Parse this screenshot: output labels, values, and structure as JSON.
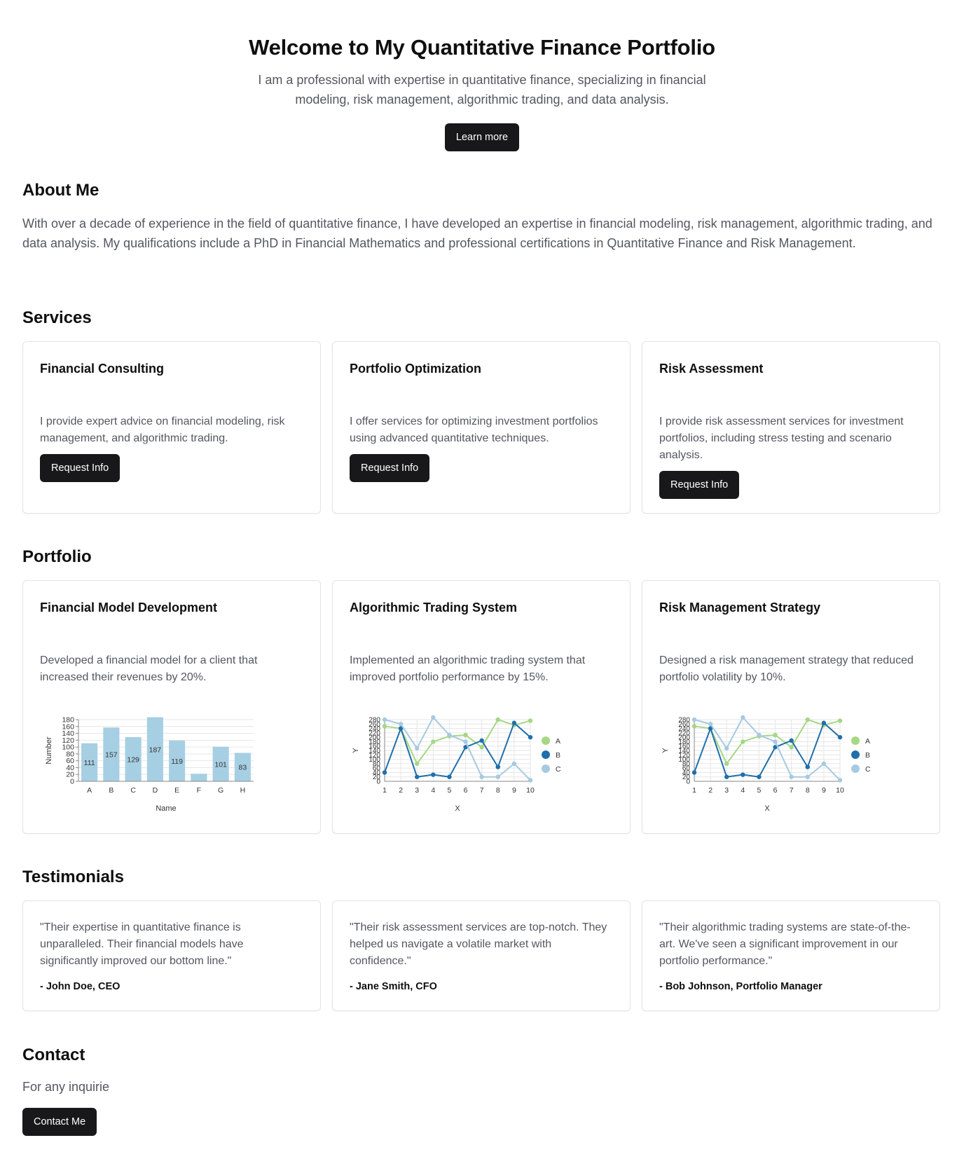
{
  "hero": {
    "title": "Welcome to My Quantitative Finance Portfolio",
    "subtitle": "I am a professional with expertise in quantitative finance, specializing in financial modeling, risk management, algorithmic trading, and data analysis.",
    "cta_label": "Learn more"
  },
  "about": {
    "heading": "About Me",
    "text": "With over a decade of experience in the field of quantitative finance, I have developed an expertise in financial modeling, risk management, algorithmic trading, and data analysis. My qualifications include a PhD in Financial Mathematics and professional certifications in Quantitative Finance and Risk Management."
  },
  "services": {
    "heading": "Services",
    "items": [
      {
        "title": "Financial Consulting",
        "description": "I provide expert advice on financial modeling, risk management, and algorithmic trading.",
        "button": "Request Info"
      },
      {
        "title": "Portfolio Optimization",
        "description": "I offer services for optimizing investment portfolios using advanced quantitative techniques.",
        "button": "Request Info"
      },
      {
        "title": "Risk Assessment",
        "description": "I provide risk assessment services for investment portfolios, including stress testing and scenario analysis.",
        "button": "Request Info"
      }
    ]
  },
  "portfolio": {
    "heading": "Portfolio",
    "items": [
      {
        "title": "Financial Model Development",
        "description": "Developed a financial model for a client that increased their revenues by 20%."
      },
      {
        "title": "Algorithmic Trading System",
        "description": "Implemented an algorithmic trading system that improved portfolio performance by 15%."
      },
      {
        "title": "Risk Management Strategy",
        "description": "Designed a risk management strategy that reduced portfolio volatility by 10%."
      }
    ]
  },
  "testimonials": {
    "heading": "Testimonials",
    "items": [
      {
        "quote": "\"Their expertise in quantitative finance is unparalleled. Their financial models have significantly improved our bottom line.\"",
        "author": "- John Doe, CEO"
      },
      {
        "quote": "\"Their risk assessment services are top-notch. They helped us navigate a volatile market with confidence.\"",
        "author": "- Jane Smith, CFO"
      },
      {
        "quote": "\"Their algorithmic trading systems are state-of-the-art. We've seen a significant improvement in our portfolio performance.\"",
        "author": "- Bob Johnson, Portfolio Manager"
      }
    ]
  },
  "contact": {
    "heading": "Contact",
    "text": "For any inquirie",
    "button": "Contact Me"
  },
  "colors": {
    "bar": "#a6cfe3",
    "series_a": "#a6d785",
    "series_b": "#1f6fab",
    "series_c": "#a6cae0",
    "button": "#18181b"
  },
  "chart_data": [
    {
      "type": "bar",
      "title": "",
      "xlabel": "Name",
      "ylabel": "Number",
      "categories": [
        "A",
        "B",
        "C",
        "D",
        "E",
        "F",
        "G",
        "H"
      ],
      "values": [
        111,
        157,
        129,
        187,
        119,
        22,
        101,
        83
      ],
      "data_labels": [
        "111",
        "157",
        "129",
        "187",
        "119",
        "",
        "101",
        "83"
      ],
      "ylim": [
        0,
        180
      ],
      "yticks": [
        0,
        20,
        40,
        60,
        80,
        100,
        120,
        140,
        160,
        180
      ],
      "grid": true
    },
    {
      "type": "line",
      "title": "",
      "xlabel": "X",
      "ylabel": "Y",
      "x": [
        1,
        2,
        3,
        4,
        5,
        6,
        7,
        8,
        9,
        10
      ],
      "ylim": [
        0,
        280
      ],
      "yticks": [
        0,
        20,
        40,
        60,
        80,
        100,
        120,
        140,
        160,
        180,
        200,
        220,
        240,
        260,
        280
      ],
      "legend": "right",
      "grid": true,
      "series": [
        {
          "name": "A",
          "values": [
            250,
            240,
            80,
            180,
            205,
            210,
            155,
            280,
            255,
            275
          ]
        },
        {
          "name": "B",
          "values": [
            40,
            240,
            20,
            30,
            20,
            155,
            185,
            65,
            265,
            200
          ]
        },
        {
          "name": "C",
          "values": [
            280,
            260,
            150,
            290,
            210,
            180,
            20,
            20,
            80,
            5
          ]
        }
      ]
    },
    {
      "type": "line",
      "title": "",
      "xlabel": "X",
      "ylabel": "Y",
      "x": [
        1,
        2,
        3,
        4,
        5,
        6,
        7,
        8,
        9,
        10
      ],
      "ylim": [
        0,
        280
      ],
      "yticks": [
        0,
        20,
        40,
        60,
        80,
        100,
        120,
        140,
        160,
        180,
        200,
        220,
        240,
        260,
        280
      ],
      "legend": "right",
      "grid": true,
      "series": [
        {
          "name": "A",
          "values": [
            250,
            240,
            80,
            180,
            205,
            210,
            155,
            280,
            255,
            275
          ]
        },
        {
          "name": "B",
          "values": [
            40,
            240,
            20,
            30,
            20,
            155,
            185,
            65,
            265,
            200
          ]
        },
        {
          "name": "C",
          "values": [
            280,
            260,
            150,
            290,
            210,
            180,
            20,
            20,
            80,
            5
          ]
        }
      ]
    }
  ]
}
